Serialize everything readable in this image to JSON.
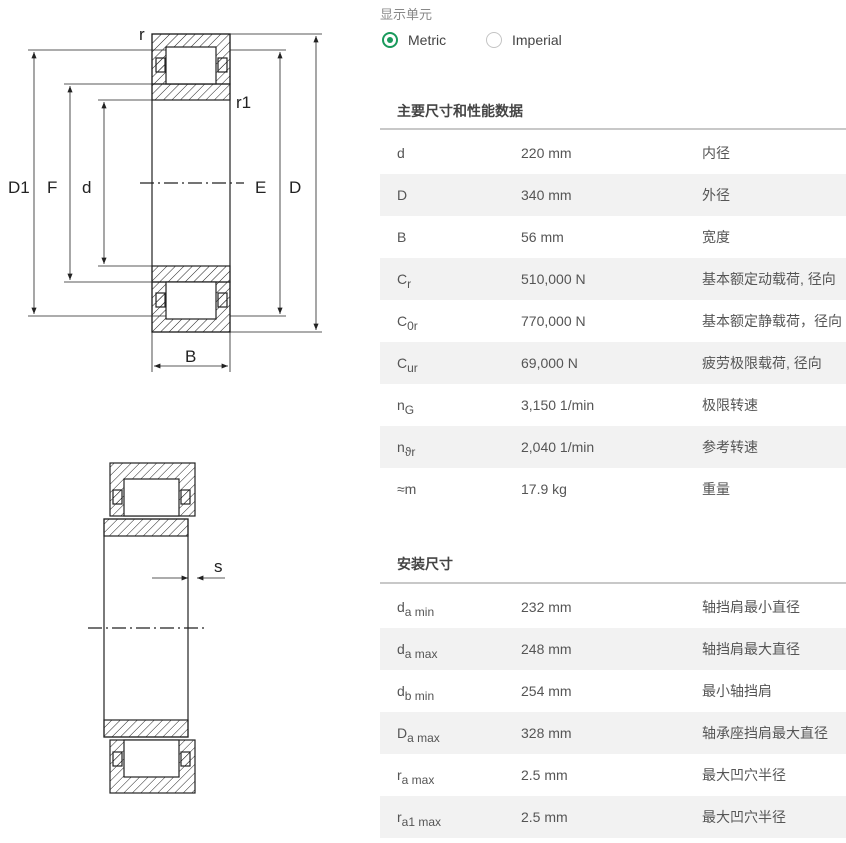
{
  "drawing_labels": {
    "r": "r",
    "r1": "r1",
    "D1": "D1",
    "F": "F",
    "d": "d",
    "E": "E",
    "D": "D",
    "B": "B",
    "s": "s"
  },
  "unit_selector": {
    "title": "显示单元",
    "options": [
      {
        "label": "Metric",
        "selected": true
      },
      {
        "label": "Imperial",
        "selected": false
      }
    ]
  },
  "main_dimensions": {
    "title": "主要尺寸和性能数据",
    "rows": [
      {
        "sym": "d",
        "sub": "",
        "value": "220 mm",
        "desc": "内径"
      },
      {
        "sym": "D",
        "sub": "",
        "value": "340 mm",
        "desc": "外径"
      },
      {
        "sym": "B",
        "sub": "",
        "value": "56 mm",
        "desc": "宽度"
      },
      {
        "sym": "C",
        "sub": "r",
        "value": "510,000 N",
        "desc": "基本额定动载荷, 径向"
      },
      {
        "sym": "C",
        "sub": "0r",
        "value": "770,000 N",
        "desc": "基本额定静载荷，径向"
      },
      {
        "sym": "C",
        "sub": "ur",
        "value": "69,000 N",
        "desc": "疲劳极限载荷, 径向"
      },
      {
        "sym": "n",
        "sub": "G",
        "value": "3,150 1/min",
        "desc": "极限转速"
      },
      {
        "sym": "n",
        "sub": "ϑr",
        "value": "2,040 1/min",
        "desc": "参考转速"
      },
      {
        "sym": "≈m",
        "sub": "",
        "value": "17.9 kg",
        "desc": "重量"
      }
    ]
  },
  "mounting_dimensions": {
    "title": "安装尺寸",
    "rows": [
      {
        "sym": "d",
        "sub": "a min",
        "value": "232 mm",
        "desc": "轴挡肩最小直径"
      },
      {
        "sym": "d",
        "sub": "a max",
        "value": "248 mm",
        "desc": "轴挡肩最大直径"
      },
      {
        "sym": "d",
        "sub": "b min",
        "value": "254 mm",
        "desc": "最小轴挡肩"
      },
      {
        "sym": "D",
        "sub": "a max",
        "value": "328 mm",
        "desc": "轴承座挡肩最大直径"
      },
      {
        "sym": "r",
        "sub": "a max",
        "value": "2.5 mm",
        "desc": "最大凹穴半径"
      },
      {
        "sym": "r",
        "sub": "a1 max",
        "value": "2.5 mm",
        "desc": "最大凹穴半径"
      }
    ]
  },
  "colors": {
    "accent": "#1a9a5c",
    "stripe": "#f2f2f2",
    "rule": "#c8c8c8"
  }
}
